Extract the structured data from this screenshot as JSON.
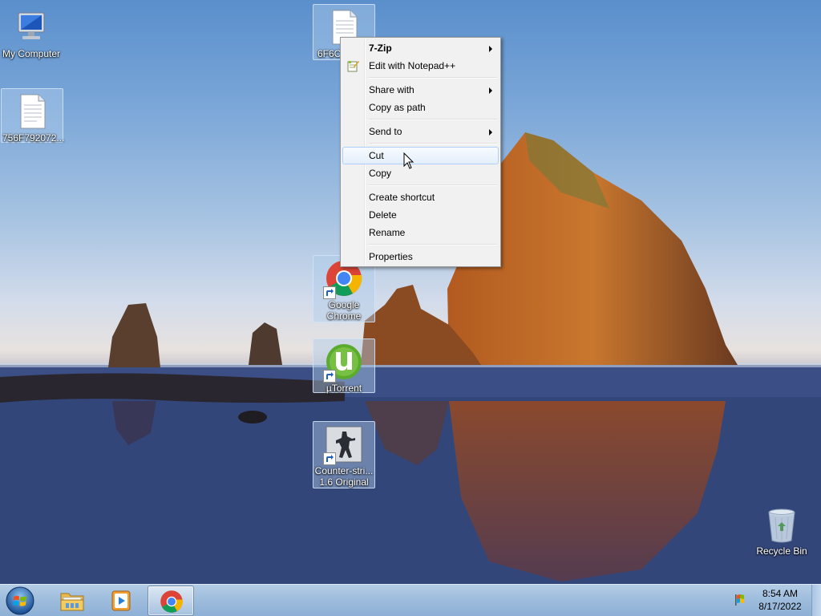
{
  "desktop_icons": {
    "my_computer": "My Computer",
    "file1": "756F792072...",
    "file2": "6F6C",
    "chrome": "Google Chrome",
    "utorrent": "µTorrent",
    "counter_strike": "Counter-stri... 1.6 Original",
    "recycle_bin": "Recycle Bin"
  },
  "context_menu": {
    "seven_zip": "7-Zip",
    "edit_notepad": "Edit with Notepad++",
    "share_with": "Share with",
    "copy_as_path": "Copy as path",
    "send_to": "Send to",
    "cut": "Cut",
    "copy": "Copy",
    "create_shortcut": "Create shortcut",
    "delete": "Delete",
    "rename": "Rename",
    "properties": "Properties",
    "highlighted": "Cut"
  },
  "taskbar": {
    "time": "8:54 AM",
    "date": "8/17/2022",
    "pinned": [
      "start-orb-icon",
      "explorer-folder-icon",
      "media-player-icon",
      "chrome-icon"
    ],
    "active_app": "chrome-icon"
  },
  "colors": {
    "menu_highlight": "#e4effb",
    "taskbar": "#9fbddd",
    "selection": "#b0cdeb"
  }
}
